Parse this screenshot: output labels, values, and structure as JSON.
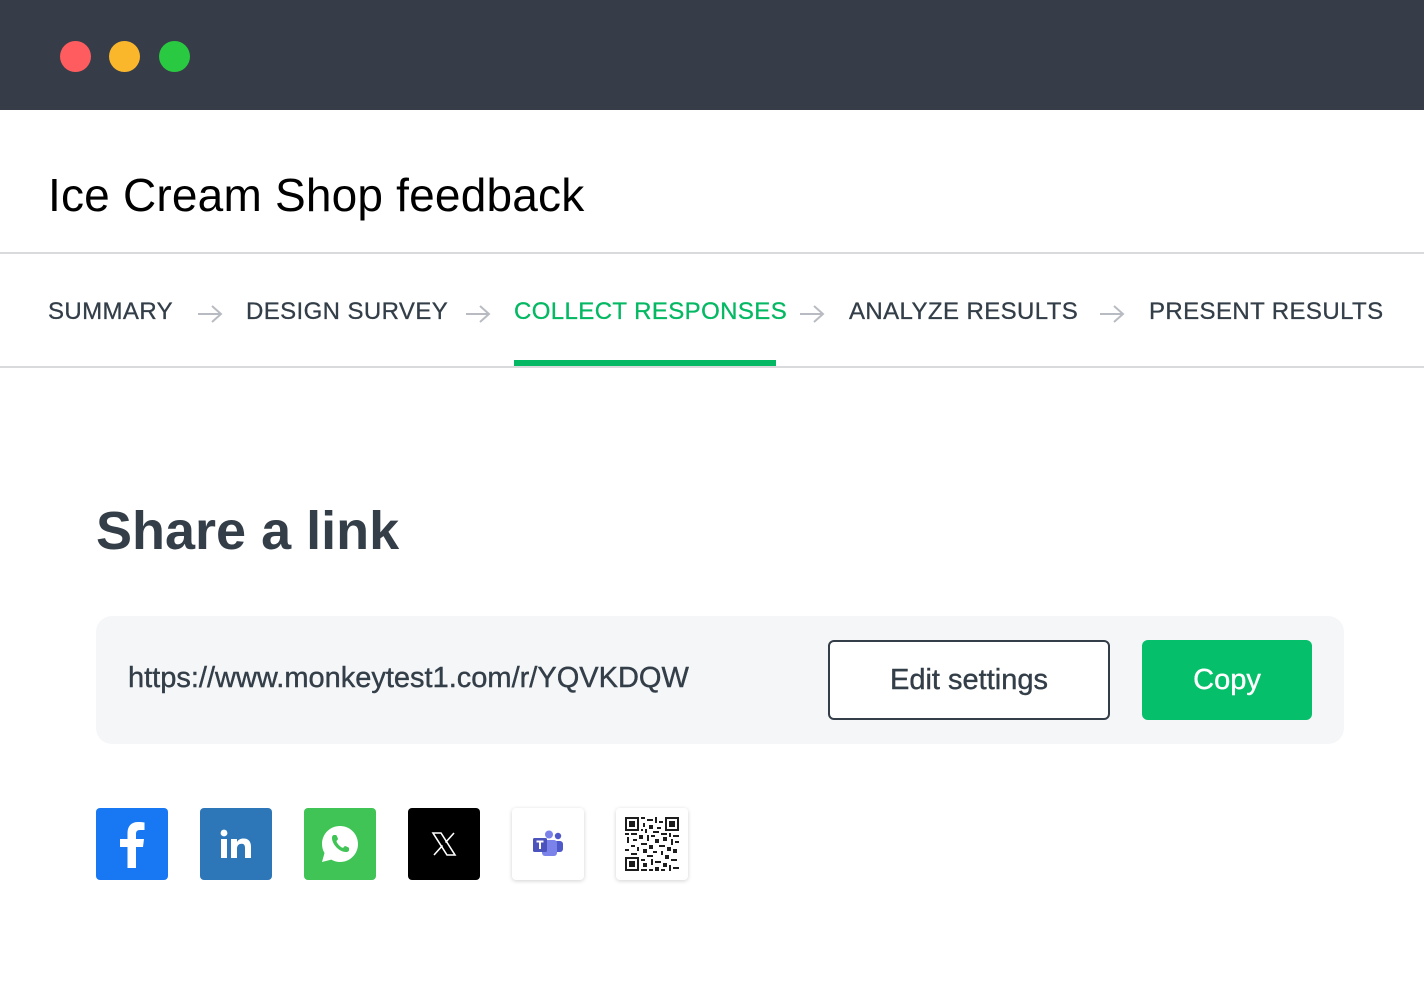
{
  "window": {
    "controls": [
      "close",
      "minimize",
      "maximize"
    ],
    "colors": {
      "close": "#fe5c5e",
      "minimize": "#fbb72c",
      "maximize": "#29c941",
      "titlebar": "#363d48"
    }
  },
  "header": {
    "title": "Ice Cream Shop feedback"
  },
  "tabs": [
    {
      "label": "SUMMARY",
      "active": false
    },
    {
      "label": "DESIGN SURVEY",
      "active": false
    },
    {
      "label": "COLLECT RESPONSES",
      "active": true
    },
    {
      "label": "ANALYZE RESULTS",
      "active": false
    },
    {
      "label": "PRESENT RESULTS",
      "active": false
    }
  ],
  "share": {
    "title": "Share a link",
    "url": "https://www.monkeytest1.com/r/YQVKDQW",
    "edit_settings_label": "Edit settings",
    "copy_label": "Copy"
  },
  "social_buttons": [
    {
      "name": "facebook",
      "icon": "facebook-icon",
      "color": "#1877f2"
    },
    {
      "name": "linkedin",
      "icon": "linkedin-icon",
      "color": "#2d77b8"
    },
    {
      "name": "whatsapp",
      "icon": "whatsapp-icon",
      "color": "#40c455"
    },
    {
      "name": "x",
      "icon": "x-icon",
      "color": "#000000"
    },
    {
      "name": "teams",
      "icon": "microsoft-teams-icon",
      "color": "#ffffff"
    },
    {
      "name": "qr-code",
      "icon": "qr-code-icon",
      "color": "#ffffff"
    }
  ],
  "colors": {
    "accent": "#05b863",
    "copy_button": "#05bf6a",
    "text": "#333e48"
  }
}
